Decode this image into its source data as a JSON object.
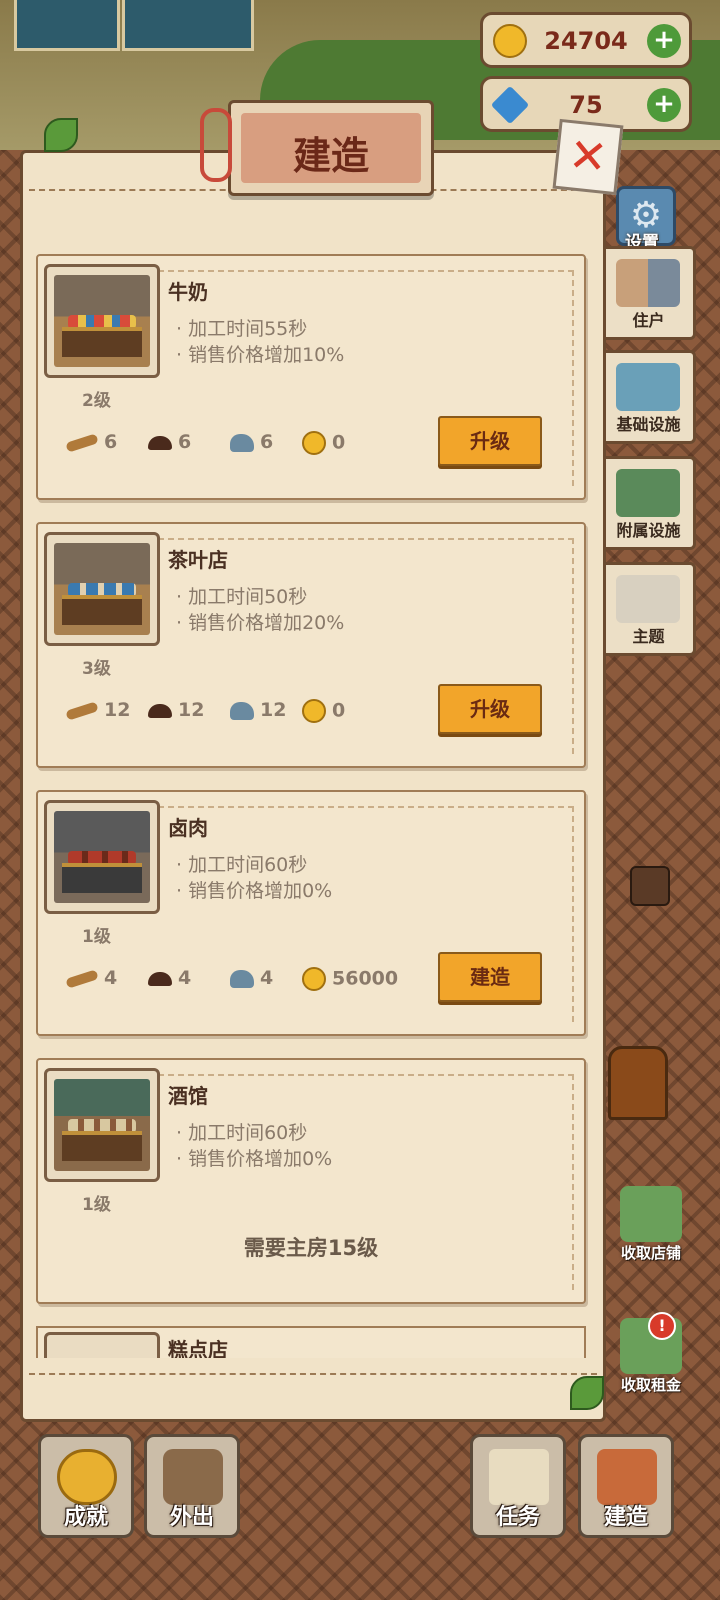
{
  "currency": {
    "gold": "24704",
    "gems": "75",
    "add_symbol": "+"
  },
  "panel": {
    "title": "建造",
    "close_symbol": "✕"
  },
  "colors": {
    "accent_button": "#f2a52a",
    "title_text": "#6b2818",
    "panel_bg": "#f1e3c8"
  },
  "cards": [
    {
      "name": "牛奶",
      "lines": [
        "· 加工时间55秒",
        "· 销售价格增加10%"
      ],
      "level": "2级",
      "resources": {
        "wood": "6",
        "dirt": "6",
        "stone": "6",
        "coin": "0"
      },
      "button": "升级"
    },
    {
      "name": "茶叶店",
      "lines": [
        "· 加工时间50秒",
        "· 销售价格增加20%"
      ],
      "level": "3级",
      "resources": {
        "wood": "12",
        "dirt": "12",
        "stone": "12",
        "coin": "0"
      },
      "button": "升级"
    },
    {
      "name": "卤肉",
      "lines": [
        "· 加工时间60秒",
        "· 销售价格增加0%"
      ],
      "level": "1级",
      "resources": {
        "wood": "4",
        "dirt": "4",
        "stone": "4",
        "coin": "56000"
      },
      "button": "建造"
    },
    {
      "name": "酒馆",
      "lines": [
        "· 加工时间60秒",
        "· 销售价格增加0%"
      ],
      "level": "1级",
      "requirement": "需要主房15级"
    }
  ],
  "partial_card_name": "糕点店",
  "side_menu": {
    "settings": "设置",
    "residents": "住户",
    "basic_facilities": "基础设施",
    "auxiliary_facilities": "附属设施",
    "theme": "主题",
    "collect_shop": "收取店铺",
    "collect_rent": "收取租金",
    "rent_badge": "!"
  },
  "bottom_bar": {
    "achievements": "成就",
    "go_out": "外出",
    "tasks": "任务",
    "build": "建造"
  }
}
